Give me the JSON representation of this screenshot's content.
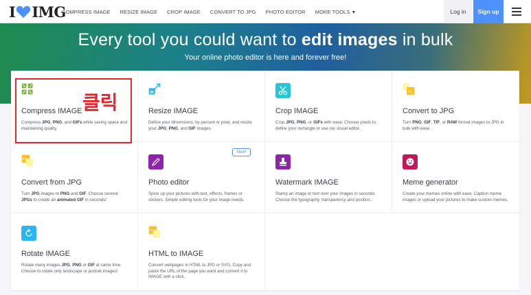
{
  "nav": {
    "logo_left": "I",
    "logo_right": "IMG",
    "menu": [
      "COMPRESS IMAGE",
      "RESIZE IMAGE",
      "CROP IMAGE",
      "CONVERT TO JPG",
      "PHOTO EDITOR",
      "MORE TOOLS"
    ],
    "login": "Log in",
    "signup": "Sign up"
  },
  "hero": {
    "title_pre": "Every tool you could want to ",
    "title_bold": "edit images",
    "title_post": " in bulk",
    "subtitle": "Your online photo editor is here and forever free!"
  },
  "tools": [
    {
      "title": "Compress IMAGE",
      "desc": "Compress JPG, PNG, and GIFs while saving space and maintaining quality.",
      "color": "#7cb342",
      "icon": "compress-icon"
    },
    {
      "title": "Resize IMAGE",
      "desc": "Define your dimensions, by percent or pixel, and resize your JPG, PNG, and GIF images.",
      "color": "#29b6f6",
      "icon": "resize-icon"
    },
    {
      "title": "Crop IMAGE",
      "desc": "Crop JPG, PNG, or GIFs with ease; Choose pixels to define your rectangle or use our visual editor.",
      "color": "#26c6da",
      "icon": "scissors-icon"
    },
    {
      "title": "Convert to JPG",
      "desc": "Turn PNG, GIF, TIF, or RAW format images to JPG in bulk with ease.",
      "color": "#fbc02d",
      "icon": "convert-to-jpg-icon"
    },
    {
      "title": "Convert from JPG",
      "desc": "Turn JPG images to PNG and GIF. Choose several JPGs to create an animated GIF in seconds!",
      "color": "#fbc02d",
      "icon": "convert-from-jpg-icon"
    },
    {
      "title": "Photo editor",
      "desc": "Spice up your pictures with text, effects, frames or stickers. Simple editing tools for your image needs.",
      "color": "#8e24aa",
      "icon": "pencil-icon"
    },
    {
      "title": "Watermark IMAGE",
      "desc": "Stamp an image or text over your images in seconds. Choose the typography, transparency and position.",
      "color": "#8e24aa",
      "icon": "stamp-icon"
    },
    {
      "title": "Meme generator",
      "desc": "Create your memes online with ease. Caption meme images or upload your pictures to make custom memes.",
      "color": "#c2185b",
      "icon": "smiley-icon"
    },
    {
      "title": "Rotate IMAGE",
      "desc": "Rotate many images JPG, PNG or GIF at same time. Choose to rotate only landscape or portrait images!",
      "color": "#29b6f6",
      "icon": "rotate-icon"
    },
    {
      "title": "HTML to IMAGE",
      "desc": "Convert webpages in HTML to JPG or SVG. Copy and paste the URL of the page you want and convert it to IMAGE with a click.",
      "color": "#fbc02d",
      "icon": "html-icon"
    }
  ],
  "badge_new": "New!",
  "annotation": "클릭",
  "icon_texts": {
    "jpg": "JPG",
    "html": "HTML"
  }
}
